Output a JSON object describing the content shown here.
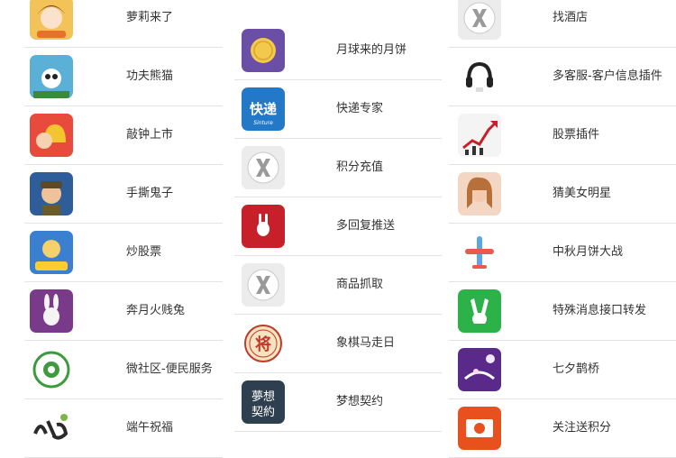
{
  "columns": [
    {
      "items": [
        {
          "label": "萝莉来了",
          "icon": "cartoon-girl-icon",
          "color": "#f3c35a"
        },
        {
          "label": "功夫熊猫",
          "icon": "kungfu-panda-icon",
          "color": "#5ab0d6"
        },
        {
          "label": "敲钟上市",
          "icon": "bell-ringer-icon",
          "color": "#e84a3c"
        },
        {
          "label": "手撕鬼子",
          "icon": "soldier-icon",
          "color": "#2f5d9a"
        },
        {
          "label": "炒股票",
          "icon": "stock-game-icon",
          "color": "#3a7fd0"
        },
        {
          "label": "奔月火贱兔",
          "icon": "rabbit-icon",
          "color": "#7a3a8a"
        },
        {
          "label": "微社区-便民服务",
          "icon": "community-logo-icon",
          "color": "#3d9a3d"
        },
        {
          "label": "端午祝福",
          "icon": "calligraphy-icon",
          "color": "#2a2a2a"
        }
      ]
    },
    {
      "items": [
        {
          "label": "月球来的月饼",
          "icon": "mooncake-icon",
          "color": "#6b4fa6"
        },
        {
          "label": "快递专家",
          "icon": "express-icon",
          "color": "#2478c8",
          "icon_text": "快递",
          "icon_subtext": "Sinture"
        },
        {
          "label": "积分充值",
          "icon": "placeholder-x-icon",
          "color": "#e8e8e8"
        },
        {
          "label": "多回复推送",
          "icon": "bunny-logo-icon",
          "color": "#c8202a"
        },
        {
          "label": "商品抓取",
          "icon": "placeholder-x-icon",
          "color": "#e8e8e8"
        },
        {
          "label": "象棋马走日",
          "icon": "chess-piece-icon",
          "color": "#c0392b",
          "icon_text": "将"
        },
        {
          "label": "梦想契约",
          "icon": "dream-contract-icon",
          "color": "#2e3f4f",
          "icon_text": "夢想契約"
        }
      ]
    },
    {
      "items": [
        {
          "label": "找酒店",
          "icon": "placeholder-x-icon",
          "color": "#e8e8e8"
        },
        {
          "label": "多客服-客户信息插件",
          "icon": "headset-icon",
          "color": "#222222"
        },
        {
          "label": "股票插件",
          "icon": "stock-chart-icon",
          "color": "#c8202a"
        },
        {
          "label": "猜美女明星",
          "icon": "portrait-icon",
          "color": "#e8b8a0"
        },
        {
          "label": "中秋月饼大战",
          "icon": "airplane-icon",
          "color": "#5aa8e0"
        },
        {
          "label": "特殊消息接口转发",
          "icon": "victory-hand-icon",
          "color": "#2db24a"
        },
        {
          "label": "七夕鹊桥",
          "icon": "magpie-bridge-icon",
          "color": "#5a2a8a"
        },
        {
          "label": "关注送积分",
          "icon": "cash-icon",
          "color": "#e8501e"
        }
      ]
    }
  ]
}
